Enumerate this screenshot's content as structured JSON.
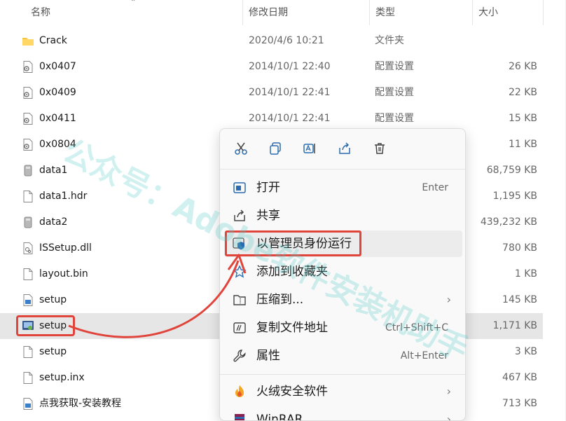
{
  "columns": {
    "name": "名称",
    "date": "修改日期",
    "type": "类型",
    "size": "大小"
  },
  "files": [
    {
      "name": "Crack",
      "date": "2020/4/6 10:21",
      "type": "文件夹",
      "size": "",
      "icon": "folder-icon"
    },
    {
      "name": "0x0407",
      "date": "2014/10/1 22:40",
      "type": "配置设置",
      "size": "26 KB",
      "icon": "settings-file-icon"
    },
    {
      "name": "0x0409",
      "date": "2014/10/1 22:41",
      "type": "配置设置",
      "size": "22 KB",
      "icon": "settings-file-icon"
    },
    {
      "name": "0x0411",
      "date": "2014/10/1 22:41",
      "type": "配置设置",
      "size": "15 KB",
      "icon": "settings-file-icon"
    },
    {
      "name": "0x0804",
      "date": "",
      "type": "",
      "size": "11 KB",
      "icon": "settings-file-icon"
    },
    {
      "name": "data1",
      "date": "",
      "type": "",
      "size": "68,759 KB",
      "icon": "cab-file-icon"
    },
    {
      "name": "data1.hdr",
      "date": "",
      "type": "",
      "size": "1,195 KB",
      "icon": "blank-file-icon"
    },
    {
      "name": "data2",
      "date": "",
      "type": "",
      "size": "439,232 KB",
      "icon": "cab-file-icon"
    },
    {
      "name": "ISSetup.dll",
      "date": "",
      "type": "",
      "size": "780 KB",
      "icon": "dll-file-icon"
    },
    {
      "name": "layout.bin",
      "date": "",
      "type": "",
      "size": "1 KB",
      "icon": "blank-file-icon"
    },
    {
      "name": "setup",
      "date": "",
      "type": "",
      "size": "145 KB",
      "icon": "image-file-icon"
    },
    {
      "name": "setup",
      "date": "",
      "type": "",
      "size": "1,171 KB",
      "icon": "setup-exe-icon",
      "selected": true
    },
    {
      "name": "setup",
      "date": "",
      "type": "",
      "size": "3 KB",
      "icon": "blank-file-icon"
    },
    {
      "name": "setup.inx",
      "date": "",
      "type": "",
      "size": "467 KB",
      "icon": "blank-file-icon"
    },
    {
      "name": "点我获取-安装教程",
      "date": "",
      "type": "",
      "size": "713 KB",
      "icon": "image-file-icon"
    }
  ],
  "context_menu": {
    "quick_actions": [
      "cut-icon",
      "copy-icon",
      "rename-icon",
      "share-icon",
      "delete-icon"
    ],
    "items": [
      {
        "label": "打开",
        "shortcut": "Enter",
        "icon": "open-icon"
      },
      {
        "label": "共享",
        "shortcut": "",
        "icon": "share-icon"
      },
      {
        "label": "以管理员身份运行",
        "shortcut": "",
        "icon": "shield-icon",
        "highlighted": true
      },
      {
        "label": "添加到收藏夹",
        "shortcut": "",
        "icon": "star-icon"
      },
      {
        "label": "压缩到...",
        "shortcut": "",
        "icon": "zip-icon",
        "submenu": true
      },
      {
        "label": "复制文件地址",
        "shortcut": "Ctrl+Shift+C",
        "icon": "copy-path-icon"
      },
      {
        "label": "属性",
        "shortcut": "Alt+Enter",
        "icon": "wrench-icon"
      },
      {
        "label": "火绒安全软件",
        "shortcut": "",
        "icon": "huorong-icon",
        "submenu": true
      },
      {
        "label": "WinRAR",
        "shortcut": "",
        "icon": "winrar-icon",
        "submenu": true
      }
    ],
    "submenu_glyph": "›"
  },
  "watermark": "公众号：Adobe软件安装机助手",
  "colors": {
    "accent": "#e0443b",
    "selection": "#e6e6e6",
    "menu_bg": "#f9f9f9",
    "watermark": "#5ac8c8"
  }
}
